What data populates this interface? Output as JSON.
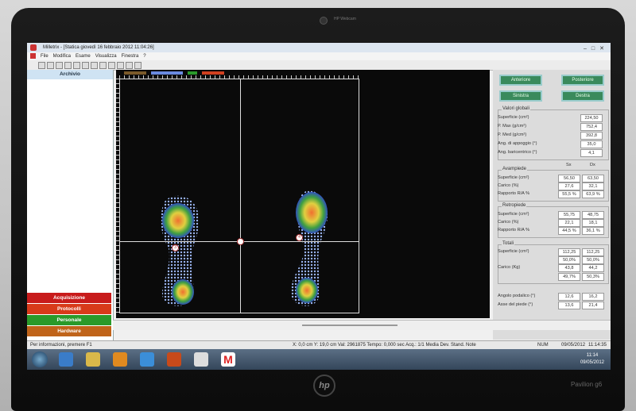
{
  "window": {
    "title": "Milletrix - [Statica giovedì 16 febbraio 2012 11:04:26]"
  },
  "webcam_label": "HP Webcam",
  "brand": "hp",
  "model": "Pavilion g6",
  "menu": [
    "File",
    "Modifica",
    "Esame",
    "Visualizza",
    "Finestra",
    "?"
  ],
  "sidebar": {
    "header": "Archivio",
    "buttons": [
      {
        "label": "Acquisizione",
        "color": "#c81b1b"
      },
      {
        "label": "Protocolli",
        "color": "#d83a1a"
      },
      {
        "label": "Personale",
        "color": "#2a9a2a"
      },
      {
        "label": "Hardware",
        "color": "#c0641a"
      }
    ]
  },
  "panel": {
    "buttons": [
      "Anteriore",
      "Posteriore",
      "Sinistra",
      "Destra"
    ],
    "global": {
      "title": "Valori globali",
      "rows": [
        {
          "label": "Superficie (cm²)",
          "value": "224,50"
        },
        {
          "label": "P. Max (g/cm²)",
          "value": "752,4"
        },
        {
          "label": "P. Med (g/cm²)",
          "value": "392,8"
        },
        {
          "label": "Ang. di appoggio (°)",
          "value": "35,0"
        },
        {
          "label": "Ang. baricentrico (°)",
          "value": "4,1"
        }
      ]
    },
    "col_sx": "Sx",
    "col_dx": "Dx",
    "avampiede": {
      "title": "Avampiede",
      "rows": [
        {
          "label": "Superficie (cm²)",
          "sx": "56,50",
          "dx": "63,50"
        },
        {
          "label": "Carico (%)",
          "sx": "27,6",
          "dx": "32,1"
        },
        {
          "label": "Rapporto R/A %",
          "sx": "55,5 %",
          "dx": "63,9 %"
        }
      ]
    },
    "retropiede": {
      "title": "Retropiede",
      "rows": [
        {
          "label": "Superficie (cm²)",
          "sx": "55,75",
          "dx": "48,75"
        },
        {
          "label": "Carico (%)",
          "sx": "22,1",
          "dx": "18,1"
        },
        {
          "label": "Rapporto R/A %",
          "sx": "44,5 %",
          "dx": "36,1 %"
        }
      ]
    },
    "totali": {
      "title": "Totali",
      "superficie_label": "Superficie (cm²)",
      "superficie_sx": "112,25",
      "superficie_dx": "112,25",
      "pct1_sx": "50,0%",
      "pct1_dx": "50,0%",
      "carico_label": "Carico (Kg)",
      "carico_sx": "43,8",
      "carico_dx": "44,2",
      "pct2_sx": "49,7%",
      "pct2_dx": "50,3%"
    },
    "extra": [
      {
        "label": "Angolo podalico (°)",
        "sx": "12,6",
        "dx": "16,2"
      },
      {
        "label": "Asse del piede (°)",
        "sx": "13,6",
        "dx": "21,4"
      }
    ]
  },
  "status": {
    "hint": "Per informazioni, premere F1",
    "coords": "X: 0,0 cm  Y: 19,0 cm  Val: 2961875  Tempo: 0,000 sec  Acq.: 1/1  Media  Dev. Stand.  Note",
    "num": "NUM",
    "date": "09/05/2012",
    "time": "11:14:35"
  },
  "markers": [
    "3",
    "4"
  ],
  "taskbar": {
    "time": "11:14",
    "date": "09/05/2012"
  }
}
